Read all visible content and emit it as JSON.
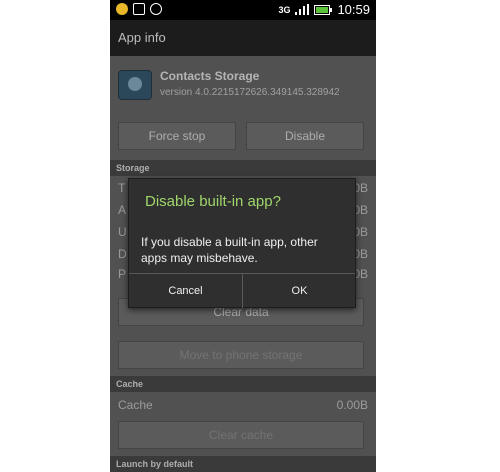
{
  "status_bar": {
    "network": "3G",
    "time": "10:59",
    "icons": [
      "notification-icon",
      "image-icon",
      "whatsapp-icon",
      "signal-icon",
      "battery-icon"
    ]
  },
  "title_bar": {
    "title": "App info"
  },
  "app": {
    "name": "Contacts Storage",
    "version": "version 4.0.2215172626.349145.328942",
    "icon": "contacts-app-icon"
  },
  "actions": {
    "force_stop": "Force stop",
    "disable": "Disable"
  },
  "storage": {
    "header": "Storage",
    "rows": [
      {
        "label": "T",
        "value": "0B"
      },
      {
        "label": "A",
        "value": "0B"
      },
      {
        "label": "U",
        "value": "0B"
      },
      {
        "label": "D",
        "value": "0B"
      },
      {
        "label": "P",
        "value": "0B"
      }
    ],
    "clear_data": "Clear data",
    "move": "Move to phone storage"
  },
  "cache": {
    "header": "Cache",
    "label": "Cache",
    "value": "0.00B",
    "clear": "Clear cache"
  },
  "launch": {
    "header": "Launch by default"
  },
  "dialog": {
    "title": "Disable built-in app?",
    "message": "If you disable a built-in app, other apps may misbehave.",
    "cancel": "Cancel",
    "ok": "OK",
    "title_color": "#9fd66a"
  }
}
